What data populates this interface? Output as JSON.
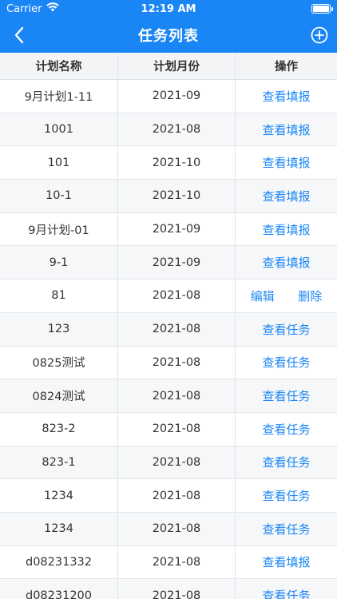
{
  "status_bar": {
    "carrier": "Carrier",
    "time": "12:19 AM"
  },
  "nav": {
    "title": "任务列表"
  },
  "table": {
    "headers": [
      "计划名称",
      "计划月份",
      "操作"
    ],
    "rows": [
      {
        "name": "9月计划1-11",
        "month": "2021-09",
        "actions": [
          "查看填报"
        ]
      },
      {
        "name": "1001",
        "month": "2021-08",
        "actions": [
          "查看填报"
        ]
      },
      {
        "name": "101",
        "month": "2021-10",
        "actions": [
          "查看填报"
        ]
      },
      {
        "name": "10-1",
        "month": "2021-10",
        "actions": [
          "查看填报"
        ]
      },
      {
        "name": "9月计划-01",
        "month": "2021-09",
        "actions": [
          "查看填报"
        ]
      },
      {
        "name": "9-1",
        "month": "2021-09",
        "actions": [
          "查看填报"
        ]
      },
      {
        "name": "81",
        "month": "2021-08",
        "actions": [
          "编辑",
          "删除"
        ]
      },
      {
        "name": "123",
        "month": "2021-08",
        "actions": [
          "查看任务"
        ]
      },
      {
        "name": "0825测试",
        "month": "2021-08",
        "actions": [
          "查看任务"
        ]
      },
      {
        "name": "0824测试",
        "month": "2021-08",
        "actions": [
          "查看任务"
        ]
      },
      {
        "name": "823-2",
        "month": "2021-08",
        "actions": [
          "查看任务"
        ]
      },
      {
        "name": "823-1",
        "month": "2021-08",
        "actions": [
          "查看任务"
        ]
      },
      {
        "name": "1234",
        "month": "2021-08",
        "actions": [
          "查看任务"
        ]
      },
      {
        "name": "1234",
        "month": "2021-08",
        "actions": [
          "查看任务"
        ]
      },
      {
        "name": "d08231332",
        "month": "2021-08",
        "actions": [
          "查看填报"
        ]
      },
      {
        "name": "d08231200",
        "month": "2021-08",
        "actions": [
          "查看任务"
        ]
      }
    ]
  },
  "colors": {
    "accent": "#1a86f5",
    "stripe": "#f6f7f9"
  }
}
